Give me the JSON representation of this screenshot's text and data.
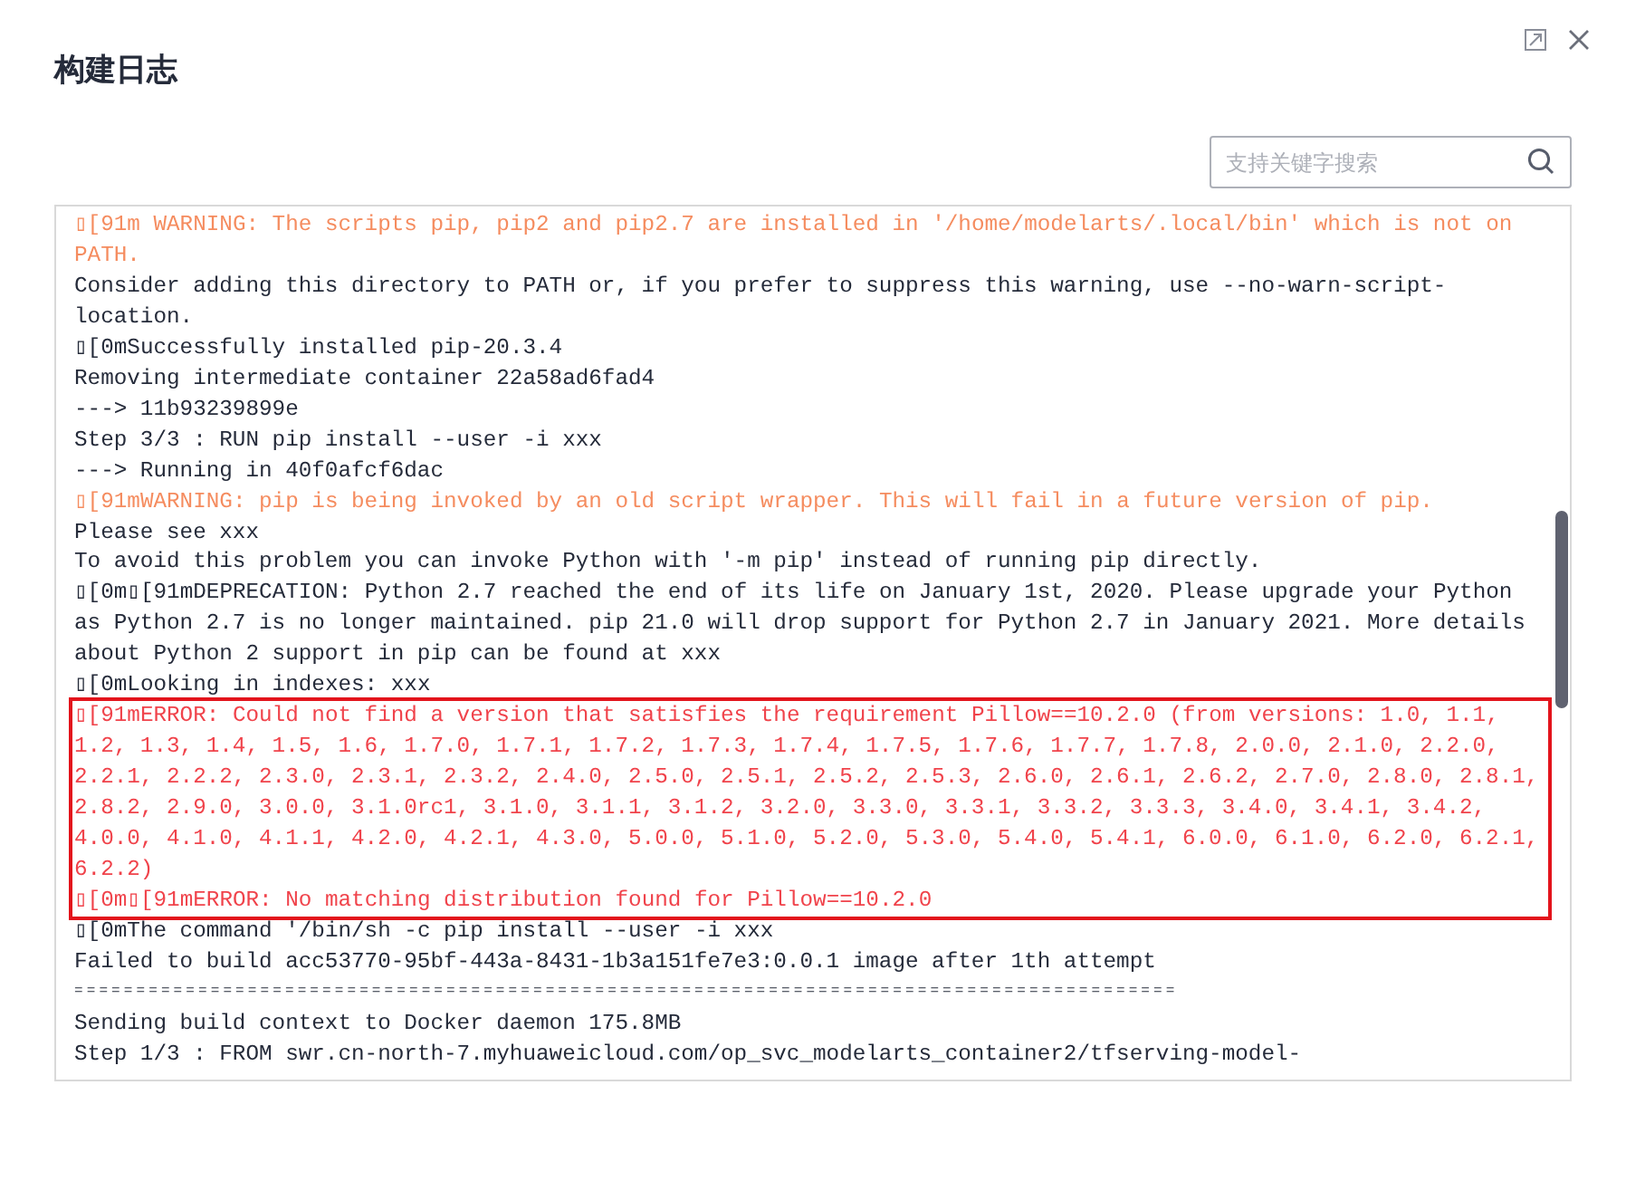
{
  "dialog": {
    "title": "构建日志"
  },
  "search": {
    "placeholder": "支持关键字搜索"
  },
  "log": {
    "blocks": [
      {
        "boxed": false,
        "lines": [
          {
            "kind": "warning",
            "text": "▯[91m WARNING: The scripts pip, pip2 and pip2.7 are installed in '/home/modelarts/.local/bin' which is not on"
          },
          {
            "kind": "warning",
            "text": "PATH."
          },
          {
            "kind": "normal",
            "text": "Consider adding this directory to PATH or, if you prefer to suppress this warning, use --no-warn-script-"
          },
          {
            "kind": "normal",
            "text": "location."
          },
          {
            "kind": "normal",
            "text": "▯[0mSuccessfully installed pip-20.3.4"
          },
          {
            "kind": "normal",
            "text": "Removing intermediate container 22a58ad6fad4"
          },
          {
            "kind": "normal",
            "text": "---> 11b93239899e"
          },
          {
            "kind": "normal",
            "text": "Step 3/3 : RUN pip install --user -i xxx"
          },
          {
            "kind": "normal",
            "text": "---> Running in 40f0afcf6dac"
          },
          {
            "kind": "warning",
            "text": "▯[91mWARNING: pip is being invoked by an old script wrapper. This will fail in a future version of pip."
          },
          {
            "kind": "normal",
            "text": "Please see xxx"
          },
          {
            "kind": "normal",
            "text": "To avoid this problem you can invoke Python with '-m pip' instead of running pip directly."
          },
          {
            "kind": "normal",
            "text": "▯[0m▯[91mDEPRECATION: Python 2.7 reached the end of its life on January 1st, 2020. Please upgrade your Python"
          },
          {
            "kind": "normal",
            "text": "as Python 2.7 is no longer maintained. pip 21.0 will drop support for Python 2.7 in January 2021. More details"
          },
          {
            "kind": "normal",
            "text": "about Python 2 support in pip can be found at xxx"
          },
          {
            "kind": "normal",
            "text": "▯[0mLooking in indexes: xxx"
          }
        ]
      },
      {
        "boxed": true,
        "lines": [
          {
            "kind": "error",
            "text": "▯[91mERROR: Could not find a version that satisfies the requirement Pillow==10.2.0 (from versions: 1.0, 1.1,"
          },
          {
            "kind": "error",
            "text": "1.2, 1.3, 1.4, 1.5, 1.6, 1.7.0, 1.7.1, 1.7.2, 1.7.3, 1.7.4, 1.7.5, 1.7.6, 1.7.7, 1.7.8, 2.0.0, 2.1.0, 2.2.0,"
          },
          {
            "kind": "error",
            "text": "2.2.1, 2.2.2, 2.3.0, 2.3.1, 2.3.2, 2.4.0, 2.5.0, 2.5.1, 2.5.2, 2.5.3, 2.6.0, 2.6.1, 2.6.2, 2.7.0, 2.8.0, 2.8.1,"
          },
          {
            "kind": "error",
            "text": "2.8.2, 2.9.0, 3.0.0, 3.1.0rc1, 3.1.0, 3.1.1, 3.1.2, 3.2.0, 3.3.0, 3.3.1, 3.3.2, 3.3.3, 3.4.0, 3.4.1, 3.4.2,"
          },
          {
            "kind": "error",
            "text": "4.0.0, 4.1.0, 4.1.1, 4.2.0, 4.2.1, 4.3.0, 5.0.0, 5.1.0, 5.2.0, 5.3.0, 5.4.0, 5.4.1, 6.0.0, 6.1.0, 6.2.0, 6.2.1,"
          },
          {
            "kind": "error",
            "text": "6.2.2)"
          },
          {
            "kind": "error",
            "text": "▯[0m▯[91mERROR: No matching distribution found for Pillow==10.2.0"
          }
        ]
      },
      {
        "boxed": false,
        "lines": [
          {
            "kind": "normal",
            "text": "▯[0mThe command '/bin/sh -c pip install --user -i xxx"
          },
          {
            "kind": "normal",
            "text": "Failed to build acc53770-95bf-443a-8431-1b3a151fe7e3:0.0.1 image after 1th attempt"
          },
          {
            "kind": "separator",
            "text": "========================================================================================="
          },
          {
            "kind": "normal",
            "text": "Sending build context to Docker daemon 175.8MB"
          },
          {
            "kind": "normal",
            "text": "Step 1/3 : FROM swr.cn-north-7.myhuaweicloud.com/op_svc_modelarts_container2/tfserving-model-"
          }
        ]
      }
    ]
  }
}
